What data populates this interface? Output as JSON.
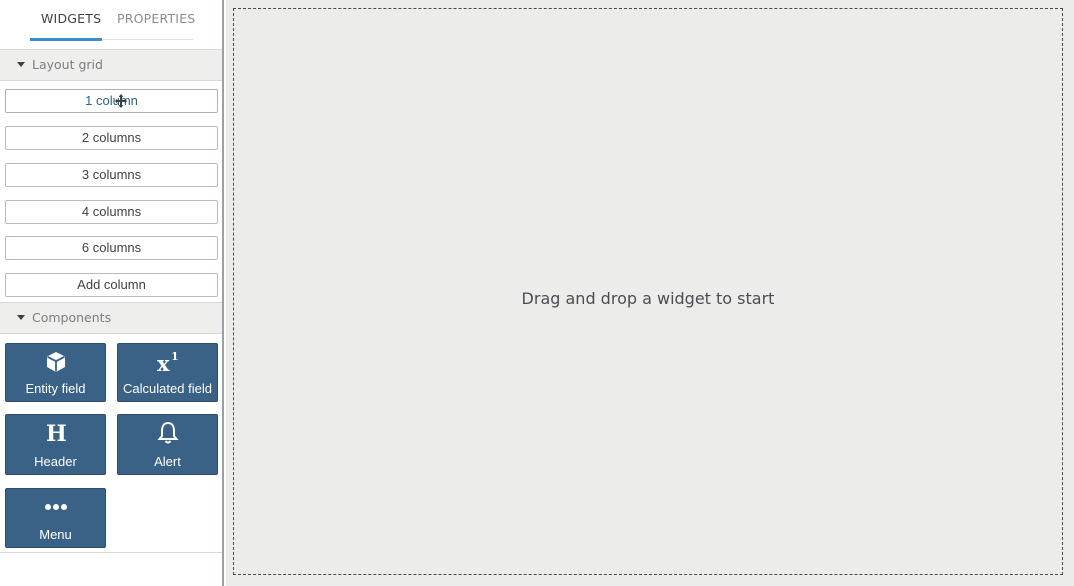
{
  "sidebar": {
    "tabs": [
      {
        "label": "WIDGETS",
        "active": true
      },
      {
        "label": "PROPERTIES",
        "active": false
      }
    ],
    "layout_section": {
      "title": "Layout grid",
      "buttons": [
        "1 column",
        "2 columns",
        "3 columns",
        "4 columns",
        "6 columns",
        "Add column"
      ]
    },
    "components_section": {
      "title": "Components",
      "tiles": [
        {
          "label": "Entity field",
          "icon": "cube-icon"
        },
        {
          "label": "Calculated field",
          "icon": "superscript-x-icon"
        },
        {
          "label": "Header",
          "icon": "heading-h-icon"
        },
        {
          "label": "Alert",
          "icon": "bell-icon"
        },
        {
          "label": "Menu",
          "icon": "ellipsis-icon"
        }
      ]
    }
  },
  "canvas": {
    "hint": "Drag and drop a widget to start"
  },
  "colors": {
    "tile_bg": "#3a6186",
    "tab_accent": "#3c8dcc",
    "canvas_bg": "#ececea"
  }
}
